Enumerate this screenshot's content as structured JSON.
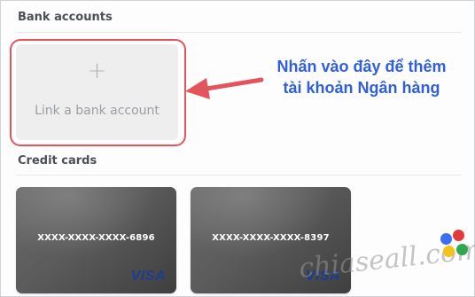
{
  "sections": {
    "bank_accounts_title": "Bank accounts",
    "credit_cards_title": "Credit cards"
  },
  "link_bank": {
    "plus_symbol": "+",
    "label": "Link a bank account"
  },
  "annotation": {
    "line1": "Nhấn vào đây để thêm",
    "line2": "tài khoản Ngân hàng",
    "color": "#2f5fe0",
    "highlight_color": "#e3545c"
  },
  "cards": [
    {
      "number": "XXXX-XXXX-XXXX-6896",
      "brand": "VISA"
    },
    {
      "number": "XXXX-XXXX-XXXX-8397",
      "brand": "VISA"
    }
  ],
  "watermark": {
    "text": "chiaseall.com",
    "dot_colors": [
      "#3b6ef0",
      "#e33b3b",
      "#f5c21b",
      "#2fa84f"
    ]
  }
}
